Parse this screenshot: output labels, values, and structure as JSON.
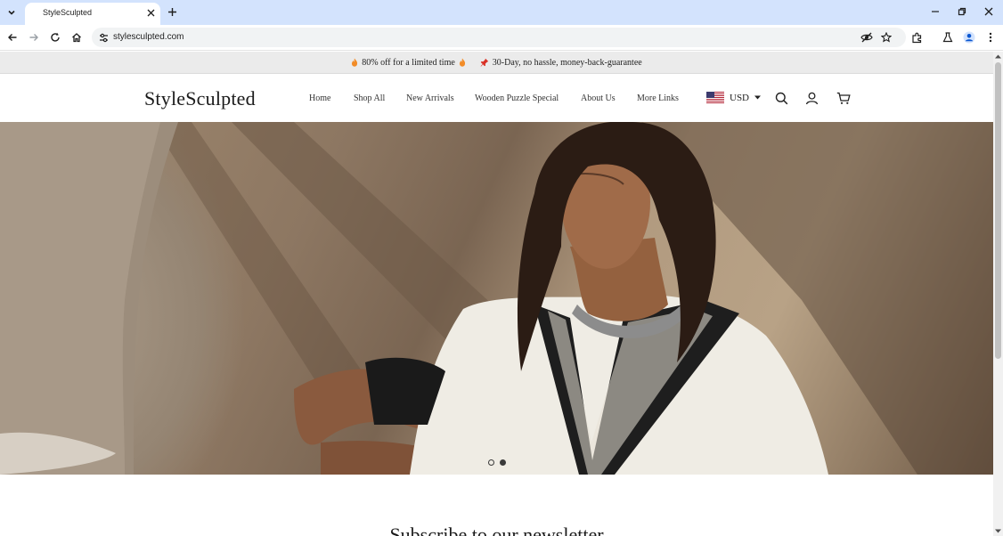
{
  "browser": {
    "tab_title": "StyleSculpted",
    "url": "stylesculpted.com"
  },
  "announcement": {
    "offer_text": "80% off for a limited time",
    "guarantee_text": "30-Day, no hassle, money-back-guarantee"
  },
  "header": {
    "logo": "StyleSculpted",
    "nav": [
      "Home",
      "Shop All",
      "New Arrivals",
      "Wooden Puzzle Special",
      "About Us",
      "More Links"
    ],
    "currency": "USD"
  },
  "hero": {
    "slide_count": 2,
    "active_slide": 2
  },
  "newsletter": {
    "title": "Subscribe to our newsletter"
  },
  "icons": {
    "tab_menu": "chevron-down-icon",
    "tab_close": "close-icon",
    "new_tab": "plus-icon",
    "minimize": "minimize-icon",
    "restore": "restore-icon",
    "close": "close-icon",
    "back": "back-arrow-icon",
    "forward": "forward-arrow-icon",
    "reload": "reload-icon",
    "home": "home-icon",
    "site_info": "tune-icon",
    "eye_off": "eye-off-icon",
    "bookmark": "star-icon",
    "extensions": "puzzle-icon",
    "labs": "flask-icon",
    "profile": "profile-icon",
    "menu": "kebab-menu-icon",
    "search": "search-icon",
    "account": "user-icon",
    "cart": "cart-icon"
  }
}
